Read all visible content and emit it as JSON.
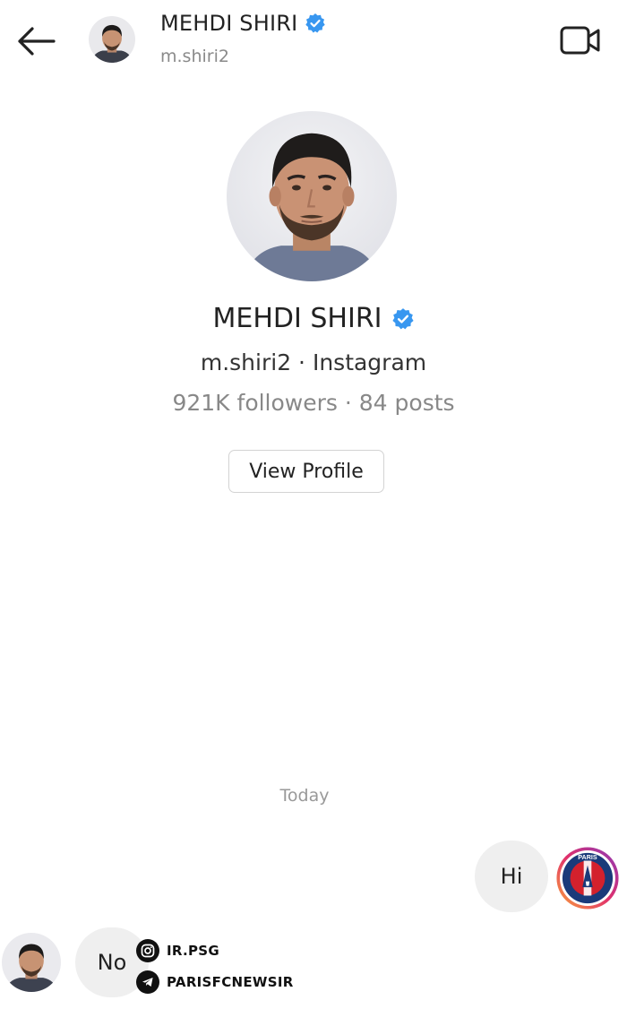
{
  "header": {
    "name": "MEHDI SHIRI",
    "username": "m.shiri2"
  },
  "profile": {
    "name": "MEHDI SHIRI",
    "subtitle": "m.shiri2 · Instagram",
    "stats": "921K followers · 84 posts",
    "view_profile_label": "View Profile"
  },
  "conversation": {
    "day_label": "Today",
    "messages": [
      {
        "direction": "outgoing",
        "text": "Hi"
      },
      {
        "direction": "incoming",
        "text": "No"
      }
    ]
  },
  "watermark": {
    "instagram_handle": "IR.PSG",
    "telegram_handle": "PARISFCNEWSIR"
  },
  "icons": {
    "back": "arrow-left-icon",
    "video": "video-camera-icon",
    "verified": "verified-badge-icon"
  },
  "colors": {
    "verified": "#3897f0",
    "bubble": "#efefef",
    "muted_text": "#8a8a8a",
    "psg_blue": "#1a3a7a",
    "psg_red": "#d3212d"
  }
}
